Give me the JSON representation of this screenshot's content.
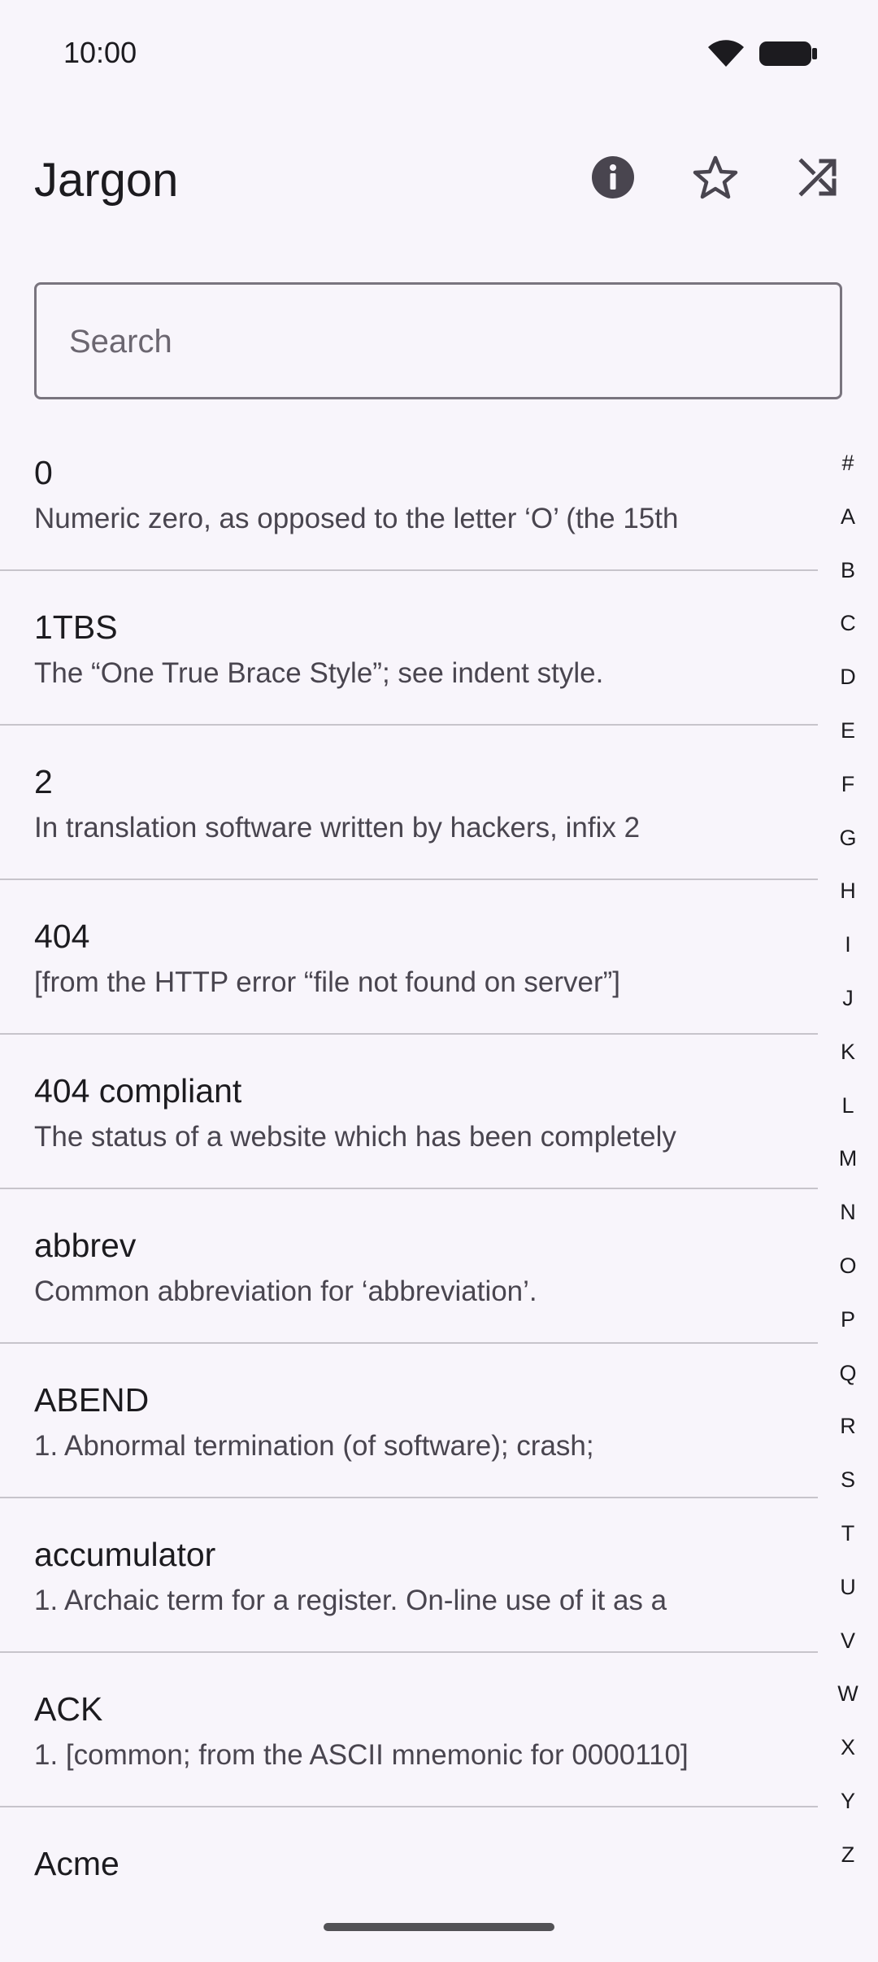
{
  "status_bar": {
    "time": "10:00",
    "icons": [
      "wifi-icon",
      "battery-icon"
    ]
  },
  "app_bar": {
    "title": "Jargon",
    "actions": [
      {
        "name": "info-icon",
        "label": "About"
      },
      {
        "name": "star-icon",
        "label": "Favorites"
      },
      {
        "name": "shuffle-icon",
        "label": "Random"
      }
    ]
  },
  "search": {
    "placeholder": "Search",
    "value": ""
  },
  "entries": [
    {
      "title": "0",
      "description": "Numeric zero, as opposed to the letter ‘O’ (the 15th"
    },
    {
      "title": "1TBS",
      "description": "The “One True Brace Style”; see indent style."
    },
    {
      "title": "2",
      "description": "In translation software written by hackers, infix 2"
    },
    {
      "title": "404",
      "description": "[from the HTTP error “file not found on server”]"
    },
    {
      "title": "404 compliant",
      "description": "The status of a website which has been completely"
    },
    {
      "title": "abbrev",
      "description": "Common abbreviation for ‘abbreviation’."
    },
    {
      "title": "ABEND",
      "description": "1. Abnormal termination (of software); crash;"
    },
    {
      "title": "accumulator",
      "description": "1. Archaic term for a register. On-line use of it as a"
    },
    {
      "title": "ACK",
      "description": "1. [common; from the ASCII mnemonic for 0000110]"
    },
    {
      "title": "Acme",
      "description": ""
    }
  ],
  "alphabet_index": [
    "#",
    "A",
    "B",
    "C",
    "D",
    "E",
    "F",
    "G",
    "H",
    "I",
    "J",
    "K",
    "L",
    "M",
    "N",
    "O",
    "P",
    "Q",
    "R",
    "S",
    "T",
    "U",
    "V",
    "W",
    "X",
    "Y",
    "Z"
  ],
  "colors": {
    "background": "#f8f5fb",
    "text": "#1c1b1f",
    "secondary_text": "#49454f",
    "divider": "#c7c4cb",
    "outline": "#79747e"
  }
}
